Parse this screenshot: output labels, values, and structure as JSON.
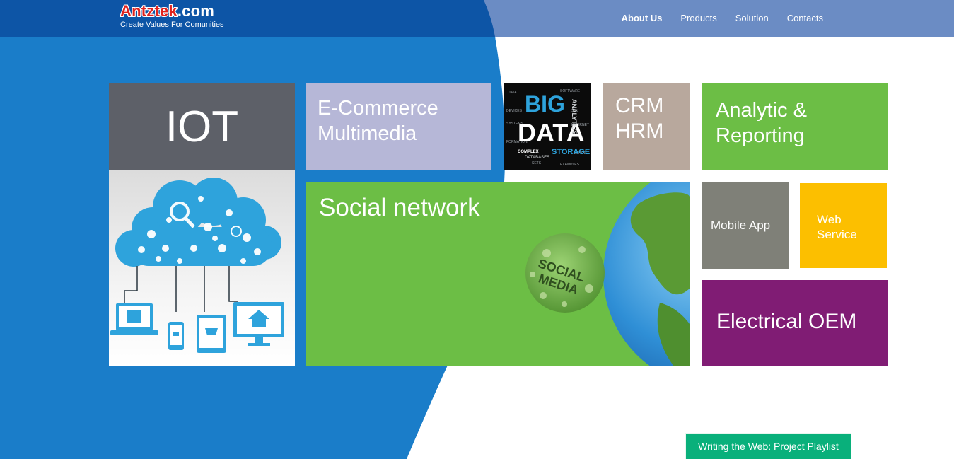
{
  "brand": {
    "name_red": "Antztek",
    "name_white": ".com",
    "tagline": "Create Values For Comunities"
  },
  "nav": {
    "items": [
      {
        "label": "About Us",
        "active": true
      },
      {
        "label": "Products",
        "active": false
      },
      {
        "label": "Solution",
        "active": false
      },
      {
        "label": "Contacts",
        "active": false
      }
    ]
  },
  "tiles": {
    "iot": {
      "label": "IOT",
      "color": "#5d6068"
    },
    "iot_image": {
      "icon": "cloud-network-devices-icon"
    },
    "ecommerce": {
      "line1": "E-Commerce",
      "line2": "Multimedia",
      "color": "#b6b7d7"
    },
    "big_data": {
      "word1": "BIG",
      "word2": "DATA",
      "word3": "ANALYTICS",
      "word4": "STORAGE",
      "word5": "COMPLEX",
      "word6": "DATABASES"
    },
    "crm": {
      "line1": "CRM",
      "line2": "HRM",
      "color": "#b8a89d"
    },
    "analytic": {
      "line1": "Analytic &",
      "line2": "Reporting",
      "color": "#6cbe45"
    },
    "social": {
      "label": "Social network",
      "globe_text_1": "SOCIAL",
      "globe_text_2": "MEDIA",
      "color": "#6cbe45"
    },
    "mobile": {
      "label": "Mobile App",
      "color": "#7f8078"
    },
    "web": {
      "line1": "Web",
      "line2": "Service",
      "color": "#fcbf00"
    },
    "electrical": {
      "label": "Electrical OEM",
      "color": "#801c74"
    }
  },
  "footer": {
    "playlist_label": "Writing the Web: Project Playlist"
  },
  "colors": {
    "header_left": "#0d55a6",
    "header_right": "#6b8cc4",
    "swoosh_blue": "#1a7dc9"
  }
}
